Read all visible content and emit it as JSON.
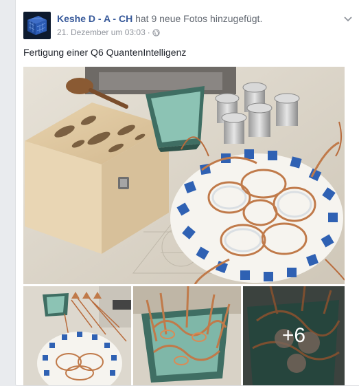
{
  "post": {
    "author": "Keshe D - A - CH",
    "action": "hat 9 neue Fotos hinzugefügt.",
    "timestamp": "21. Dezember um 03:03",
    "separator": "·",
    "privacy_icon": "globe-icon",
    "menu_icon": "chevron-down-icon",
    "text": "Fertigung einer Q6 QuantenIntelligenz",
    "more_photos_label": "+6",
    "photo_count": 9
  },
  "colors": {
    "link": "#365899",
    "secondary_text": "#90949c",
    "page_background": "#e9ebee",
    "card_background": "#ffffff"
  }
}
